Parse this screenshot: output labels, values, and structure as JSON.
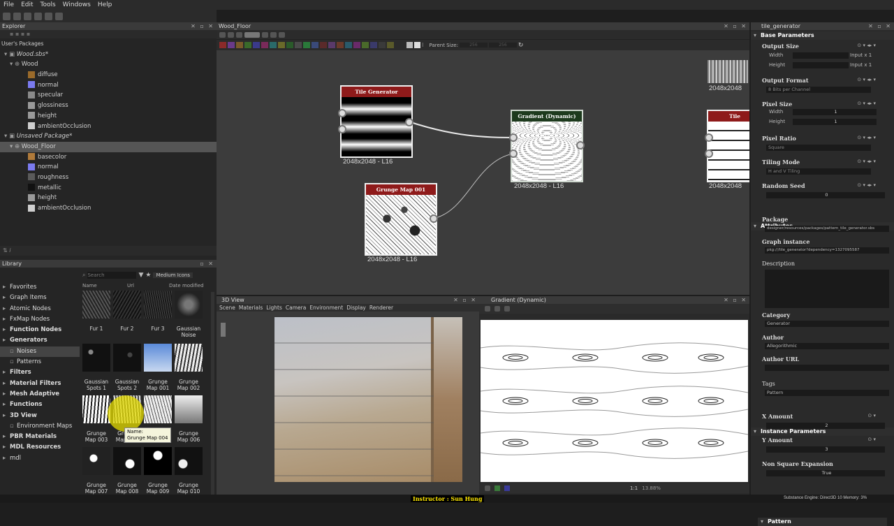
{
  "menu": [
    "File",
    "Edit",
    "Tools",
    "Windows",
    "Help"
  ],
  "explorer": {
    "title": "Explorer",
    "user_packages": "User's Packages",
    "package_name": "Wood.sbs*",
    "graph_name": "Wood",
    "wood_outputs": [
      {
        "label": "diffuse",
        "color": "#9a6a2a"
      },
      {
        "label": "normal",
        "color": "#7b7bf0"
      },
      {
        "label": "specular",
        "color": "#8a8a8a"
      },
      {
        "label": "glossiness",
        "color": "#9a9a9a"
      },
      {
        "label": "height",
        "color": "#9a9a9a"
      },
      {
        "label": "ambientOcclusion",
        "color": "#cfcfcf"
      }
    ],
    "unsaved_package": "Unsaved Package*",
    "wood_floor": "Wood_Floor",
    "floor_outputs": [
      {
        "label": "basecolor",
        "color": "#b07a3a"
      },
      {
        "label": "normal",
        "color": "#7b7bf0"
      },
      {
        "label": "roughness",
        "color": "#5a5a5a"
      },
      {
        "label": "metallic",
        "color": "#111111"
      },
      {
        "label": "height",
        "color": "#9a9a9a"
      },
      {
        "label": "ambientOcclusion",
        "color": "#cfcfcf"
      }
    ]
  },
  "library": {
    "title": "Library",
    "search_placeholder": "Search",
    "view_mode": "Medium Icons",
    "columns": [
      "Name",
      "Url",
      "Date modified"
    ],
    "categories": [
      {
        "label": "Favorites",
        "level": 0,
        "bold": false
      },
      {
        "label": "Graph Items",
        "level": 0,
        "bold": false
      },
      {
        "label": "Atomic Nodes",
        "level": 0,
        "bold": false
      },
      {
        "label": "FxMap Nodes",
        "level": 0,
        "bold": false
      },
      {
        "label": "Function Nodes",
        "level": 0,
        "bold": true
      },
      {
        "label": "Generators",
        "level": 0,
        "bold": true
      },
      {
        "label": "Noises",
        "level": 1,
        "bold": false
      },
      {
        "label": "Patterns",
        "level": 1,
        "bold": false
      },
      {
        "label": "Filters",
        "level": 0,
        "bold": true
      },
      {
        "label": "Material Filters",
        "level": 0,
        "bold": true
      },
      {
        "label": "Mesh Adaptive",
        "level": 0,
        "bold": true
      },
      {
        "label": "Functions",
        "level": 0,
        "bold": true
      },
      {
        "label": "3D View",
        "level": 0,
        "bold": true
      },
      {
        "label": "Environment Maps",
        "level": 1,
        "bold": false
      },
      {
        "label": "PBR Materials",
        "level": 0,
        "bold": true
      },
      {
        "label": "MDL Resources",
        "level": 0,
        "bold": true
      },
      {
        "label": "mdl",
        "level": 0,
        "bold": false
      }
    ],
    "thumb_rows": [
      [
        "Fur 1",
        "Fur 2",
        "Fur 3",
        "Gaussian Noise"
      ],
      [
        "Gaussian Spots 1",
        "Gaussian Spots 2",
        "Grunge Map 001",
        "Grunge Map 002"
      ],
      [
        "Grunge Map 003",
        "Grunge Map 004",
        "Grunge Map 005",
        "Grunge Map 006"
      ],
      [
        "Grunge Map 007",
        "Grunge Map 008",
        "Grunge Map 009",
        "Grunge Map 010"
      ]
    ],
    "tooltip": {
      "label": "Name:",
      "value": "Grunge Map 004"
    }
  },
  "graph": {
    "tab": "Wood_Floor",
    "parent_size_label": "Parent Size:",
    "parent_size_values": [
      "256",
      "256"
    ],
    "nodes": [
      {
        "title": "Tile Generator",
        "size": "2048x2048 - L16"
      },
      {
        "title": "Grunge Map 001",
        "size": "2048x2048 - L16"
      },
      {
        "title": "Gradient (Dynamic)",
        "size": "2048x2048 - L16"
      },
      {
        "title": "Tile Gen",
        "size": "2048x2048"
      },
      {
        "title": "",
        "size": "2048x2048"
      }
    ]
  },
  "view3d": {
    "title": "3D View",
    "menu": [
      "Scene",
      "Materials",
      "Lights",
      "Camera",
      "Environment",
      "Display",
      "Renderer"
    ]
  },
  "view2d": {
    "title": "Gradient (Dynamic)",
    "zoom": "13.88%",
    "ratio": "1:1"
  },
  "props": {
    "tab": "tile_generator",
    "base_params": "Base Parameters",
    "output_size": "Output Size",
    "width": "Width",
    "height": "Height",
    "input_x1": "Input x 1",
    "output_format": "Output Format",
    "output_format_value": "8 Bits per Channel",
    "pixel_size": "Pixel Size",
    "one": "1",
    "pixel_ratio": "Pixel Ratio",
    "pixel_ratio_value": "Square",
    "tiling_mode": "Tiling Mode",
    "tiling_mode_value": "H and V Tiling",
    "random_seed": "Random Seed",
    "random_seed_value": "0",
    "attributes": "Attributes",
    "package": "Package",
    "package_value": "designer/resources/packages/pattern_tile_generator.sbs",
    "graph_instance": "Graph instance",
    "graph_instance_value": "pkg:///tile_generator?dependency=1327095587",
    "description": "Description",
    "category": "Category",
    "category_value": "Generator",
    "author": "Author",
    "author_value": "Allegorithmic",
    "author_url": "Author URL",
    "tags": "Tags",
    "tags_value": "Pattern",
    "instance_params": "Instance Parameters",
    "x_amount": "X Amount",
    "x_amount_value": "2",
    "y_amount": "Y Amount",
    "y_amount_value": "3",
    "non_square": "Non Square Expansion",
    "non_square_value": "True",
    "pattern": "Pattern"
  },
  "status": {
    "instructor": "Instructor : Sun Hung",
    "engine": "Substance Engine: Direct3D 10  Memory: 3%"
  }
}
